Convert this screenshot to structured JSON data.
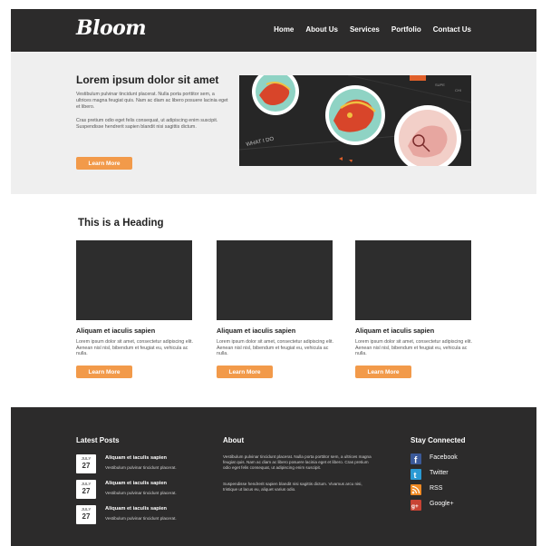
{
  "header": {
    "logo": "Bloom",
    "nav": [
      "Home",
      "About Us",
      "Services",
      "Portfolio",
      "Contact Us"
    ]
  },
  "hero": {
    "title": "Lorem ipsum dolor sit amet",
    "paragraph1": "Vestibulum pulvinar tincidunt placerat. Nulla porta porttitor sem, a ultrices magna feugiat quis. Nam ac diam ac libero posuere lacinia eget et libero.",
    "paragraph2": "Cras pretium odio eget felis consequat, ut adipiscing enim suscipit. Suspendisse hendrerit sapien blandit nisi sagittis dictum.",
    "button": "Learn More"
  },
  "section": {
    "heading": "This is a Heading",
    "cards": [
      {
        "title": "Aliquam et iaculis sapien",
        "text": "Lorem ipsum dolor sit amet, consectetur adipiscing elit. Aenean nisl nisl, bibendum et feugiat eu, vehicula ac nulla.",
        "button": "Learn More"
      },
      {
        "title": "Aliquam et iaculis sapien",
        "text": "Lorem ipsum dolor sit amet, consectetur adipiscing elit. Aenean nisl nisl, bibendum et feugiat eu, vehicula ac nulla.",
        "button": "Learn More"
      },
      {
        "title": "Aliquam et iaculis sapien",
        "text": "Lorem ipsum dolor sit amet, consectetur adipiscing elit. Aenean nisl nisl, bibendum et feugiat eu, vehicula ac nulla.",
        "button": "Learn More"
      }
    ]
  },
  "footer": {
    "latest_title": "Latest Posts",
    "posts": [
      {
        "month": "JULY",
        "day": "27",
        "title": "Aliquam et iaculis sapien",
        "sub": "Vestibulum pulvinar tincidunt placerat."
      },
      {
        "month": "JULY",
        "day": "27",
        "title": "Aliquam et iaculis sapien",
        "sub": "Vestibulum pulvinar tincidunt placerat."
      },
      {
        "month": "JULY",
        "day": "27",
        "title": "Aliquam et iaculis sapien",
        "sub": "Vestibulum pulvinar tincidunt placerat."
      }
    ],
    "about_title": "About",
    "about_p1": "Vestibulum pulvinar tincidunt placerat. Nulla porta porttitor sem, a ultrices magna feugiat quis. Nam ac diam ac libero posuere lacinia eget et libero. Cras pretium odio eget felis consequat, ut adipiscing enim suscipit.",
    "about_p2": "Suspendisse hendrerit sapien blandit nisi sagittis dictum. Vivamus arcu nisi, tristique ut lacus eu, aliquet varius odio.",
    "social_title": "Stay Connected",
    "social": [
      {
        "label": "Facebook",
        "icon": "facebook-icon"
      },
      {
        "label": "Twitter",
        "icon": "twitter-icon"
      },
      {
        "label": "RSS",
        "icon": "rss-icon"
      },
      {
        "label": "Google+",
        "icon": "google-plus-icon"
      }
    ]
  },
  "colors": {
    "dark": "#2c2b2b",
    "hero_bg": "#efefef",
    "accent": "#f29a4a",
    "thumb": "#2d2d2d"
  }
}
